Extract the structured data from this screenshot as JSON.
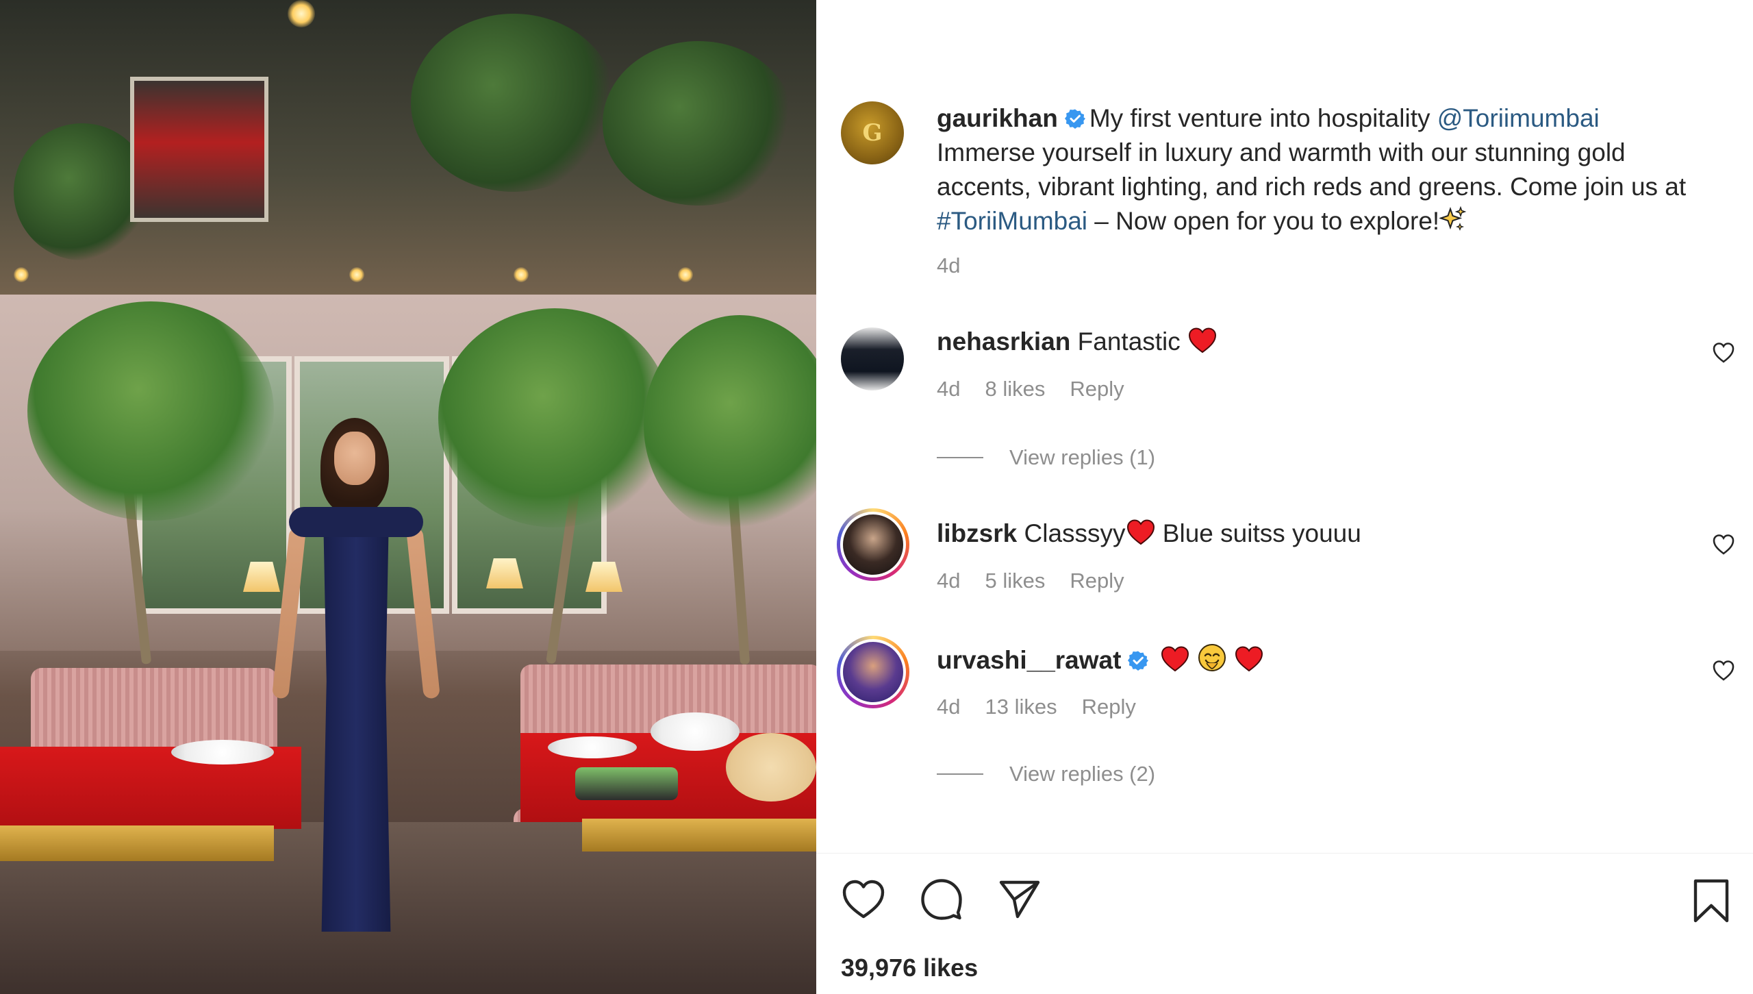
{
  "post": {
    "username": "gaurikhan",
    "avatar_letter": "G",
    "caption_line1": "My first venture into hospitality ",
    "mention": "@Toriimumbai",
    "caption_line2": "Immerse yourself in luxury and warmth with our stunning gold accents, vibrant lighting, and rich reds and greens. Come join us at ",
    "hashtag": "#ToriiMumbai",
    "caption_line3": " – Now open for you to explore!",
    "time": "4d",
    "likes": "39,976 likes"
  },
  "comments": [
    {
      "username": "nehasrkian",
      "text": "Fantastic",
      "time": "4d",
      "likes": "8 likes",
      "reply": "Reply",
      "view_replies": "View replies (1)"
    },
    {
      "username": "libzsrk",
      "text_before": "Classsyy",
      "text_after": " Blue suitss youuu",
      "time": "4d",
      "likes": "5 likes",
      "reply": "Reply"
    },
    {
      "username": "urvashi__rawat",
      "time": "4d",
      "likes": "13 likes",
      "reply": "Reply",
      "view_replies": "View replies (2)"
    }
  ],
  "colors": {
    "link": "#2b5a82",
    "verified": "#3897f0",
    "heart_red": "#ed1c24",
    "meta_gray": "#8e8e8e"
  },
  "icons": [
    "verified-badge-icon",
    "red-heart-icon",
    "sparkles-icon",
    "smiling-face-icon",
    "like-heart-icon",
    "comment-icon",
    "share-icon",
    "bookmark-icon"
  ]
}
